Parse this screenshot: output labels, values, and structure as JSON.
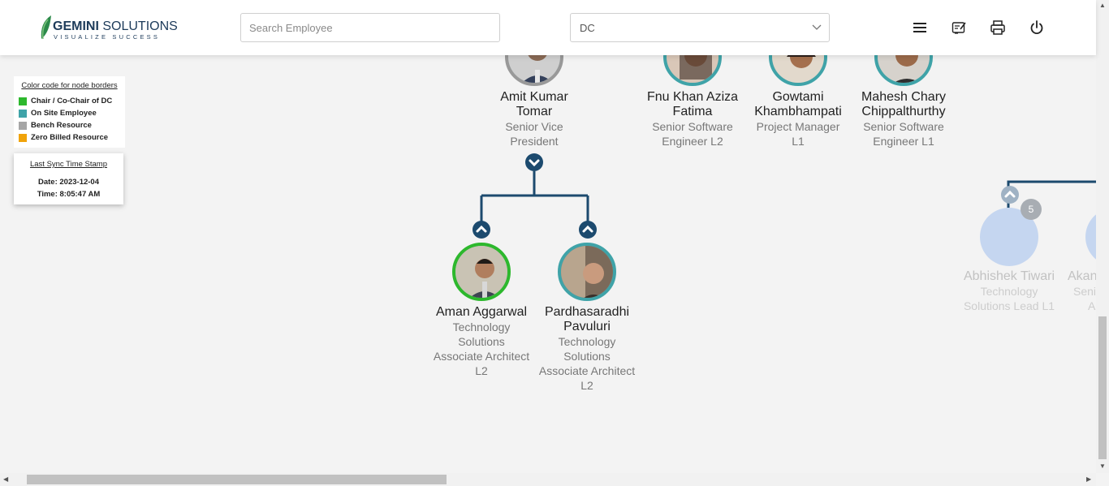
{
  "header": {
    "logo_brand": "GEMINI",
    "logo_company": "SOLUTIONS",
    "logo_tagline": "VISUALIZE SUCCESS",
    "search_placeholder": "Search Employee",
    "dc_selected": "DC",
    "icons": [
      "menu-icon",
      "checklist-icon",
      "print-icon",
      "power-icon"
    ]
  },
  "legend": {
    "title": "Color code for node borders",
    "items": [
      {
        "label": "Chair / Co-Chair of DC",
        "color": "#2db82d"
      },
      {
        "label": "On Site Employee",
        "color": "#3fa3a8"
      },
      {
        "label": "Bench Resource",
        "color": "#a6a6a6"
      },
      {
        "label": "Zero Billed Resource",
        "color": "#f0a30a"
      }
    ]
  },
  "sync": {
    "title": "Last Sync Time Stamp",
    "date": "Date: 2023-12-04",
    "time": "Time: 8:05:47 AM"
  },
  "nodes": {
    "amit": {
      "name_1": "Amit Kumar",
      "name_2": "Tomar",
      "title_1": "Senior Vice",
      "title_2": "President"
    },
    "fnu": {
      "name_1": "Fnu Khan Aziza",
      "name_2": "Fatima",
      "title_1": "Senior Software",
      "title_2": "Engineer L2"
    },
    "gowtami": {
      "name_1": "Gowtami",
      "name_2": "Khambhampati",
      "title_1": "Project Manager",
      "title_2": "L1"
    },
    "mahesh": {
      "name_1": "Mahesh Chary",
      "name_2": "Chippalthurthy",
      "title_1": "Senior Software",
      "title_2": "Engineer L1"
    },
    "aman": {
      "name_1": "Aman Aggarwal",
      "title_1": "Technology",
      "title_2": "Solutions",
      "title_3": "Associate Architect",
      "title_4": "L2"
    },
    "pardha": {
      "name_1": "Pardhasaradhi",
      "name_2": "Pavuluri",
      "title_1": "Technology",
      "title_2": "Solutions",
      "title_3": "Associate Architect",
      "title_4": "L2"
    },
    "abhishek": {
      "name_1": "Abhishek Tiwari",
      "title_1": "Technology",
      "title_2": "Solutions Lead L1",
      "badge": "5"
    },
    "akan": {
      "name_1": "Akan",
      "title_1": "Seni",
      "title_2": "A"
    }
  },
  "colors": {
    "connector": "#1c4a6e",
    "chair_border": "#2db82d",
    "onsite_border": "#3fa3a8",
    "faded_node": "#c5d6f0"
  }
}
